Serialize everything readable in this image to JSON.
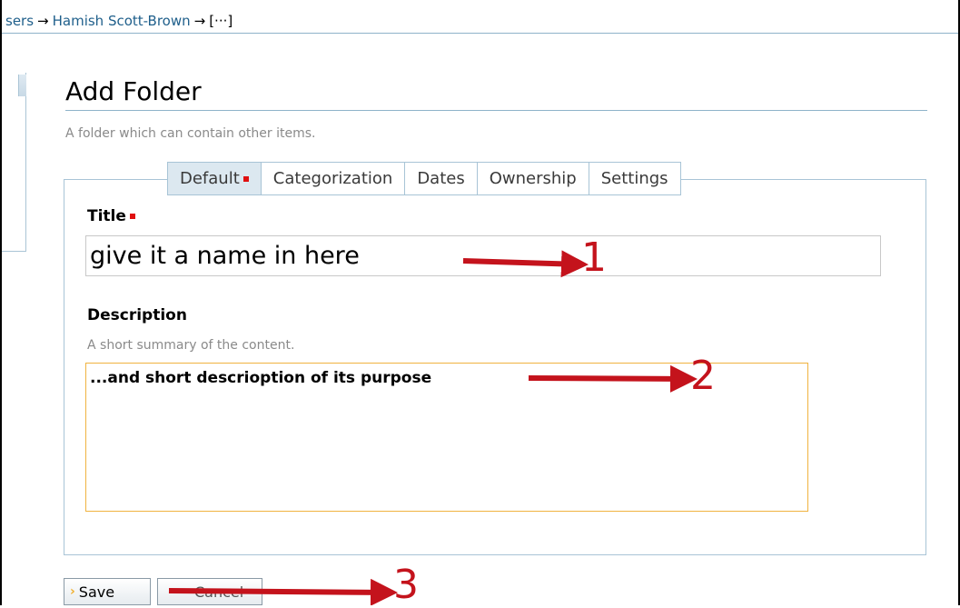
{
  "breadcrumb": {
    "items": [
      "sers",
      "Hamish Scott-Brown",
      "[···]"
    ],
    "separator": "→"
  },
  "page": {
    "title": "Add Folder",
    "description": "A folder which can contain other items."
  },
  "tabs": [
    {
      "label": "Default",
      "required": true,
      "active": true
    },
    {
      "label": "Categorization"
    },
    {
      "label": "Dates"
    },
    {
      "label": "Ownership"
    },
    {
      "label": "Settings"
    }
  ],
  "fields": {
    "title": {
      "label": "Title",
      "required": true,
      "value": "give it a name in here"
    },
    "description": {
      "label": "Description",
      "help": "A short summary of the content.",
      "value": "...and short descrioption of its purpose"
    }
  },
  "buttons": {
    "save": "Save",
    "cancel": "Cancel"
  },
  "annotations": {
    "one": "1",
    "two": "2",
    "three": "3"
  },
  "colors": {
    "annotation": "#c4131c",
    "required": "#e01010",
    "link": "#1f5f8b",
    "focus_border": "#f0b340"
  }
}
